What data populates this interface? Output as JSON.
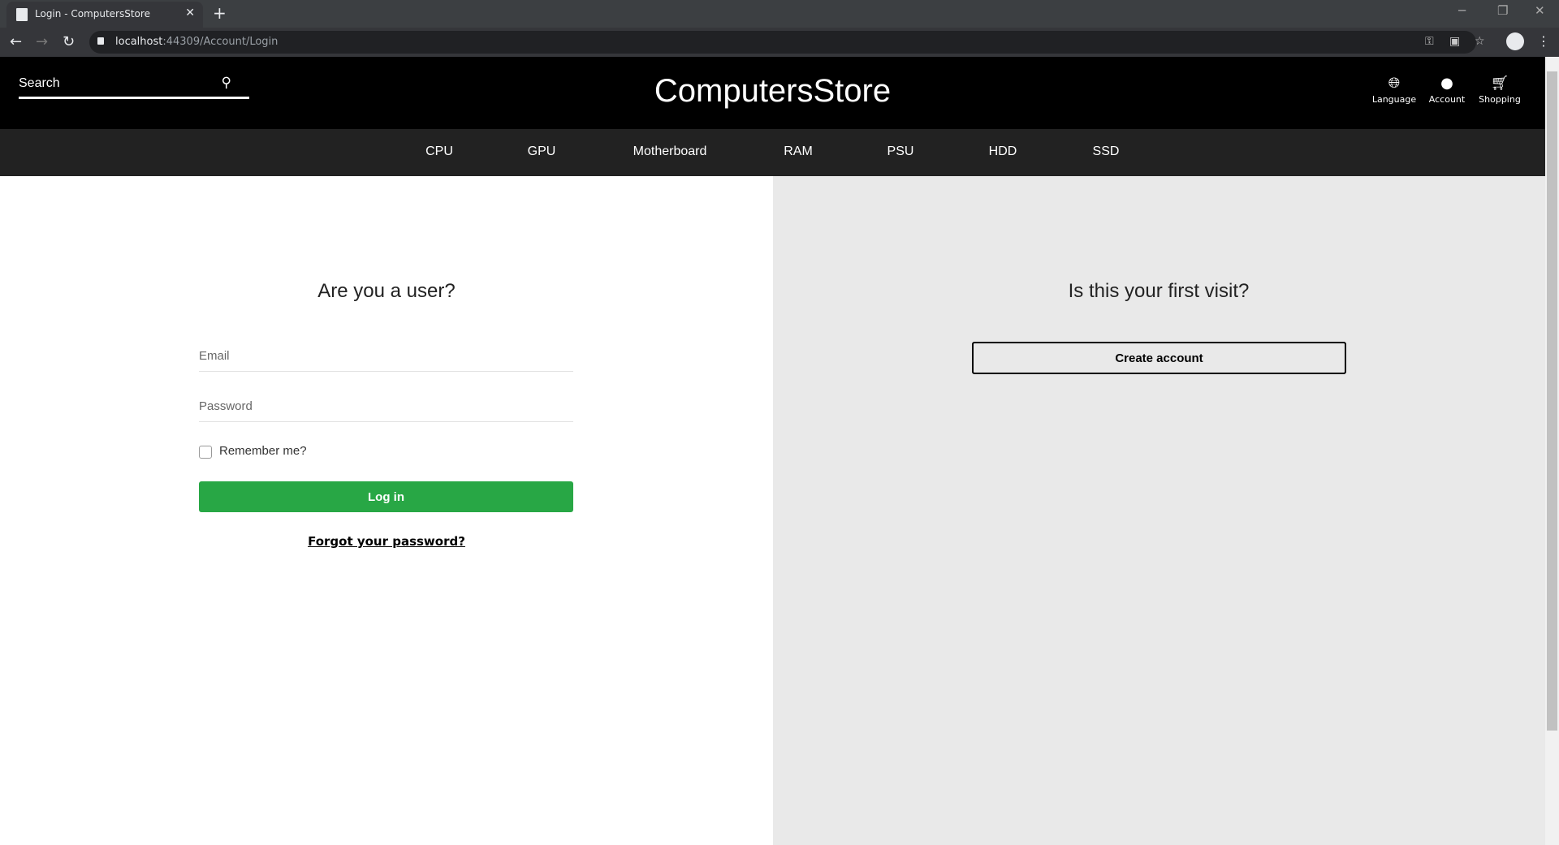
{
  "browser": {
    "tab_title": "Login - ComputersStore",
    "url_host": "localhost",
    "url_path": ":44309/Account/Login"
  },
  "header": {
    "search_placeholder": "Search",
    "brand": "ComputersStore",
    "actions": [
      {
        "label": "Language",
        "icon": "globe-icon"
      },
      {
        "label": "Account",
        "icon": "user-icon"
      },
      {
        "label": "Shopping",
        "icon": "cart-icon"
      }
    ]
  },
  "menu": [
    "CPU",
    "GPU",
    "Motherboard",
    "RAM",
    "PSU",
    "HDD",
    "SSD"
  ],
  "login": {
    "heading": "Are you a user?",
    "email_placeholder": "Email",
    "password_placeholder": "Password",
    "remember": "Remember me?",
    "submit": "Log in",
    "forgot": "Forgot your password?",
    "submit_color": "#28a745"
  },
  "register": {
    "heading": "Is this your first visit?",
    "button": "Create account"
  }
}
